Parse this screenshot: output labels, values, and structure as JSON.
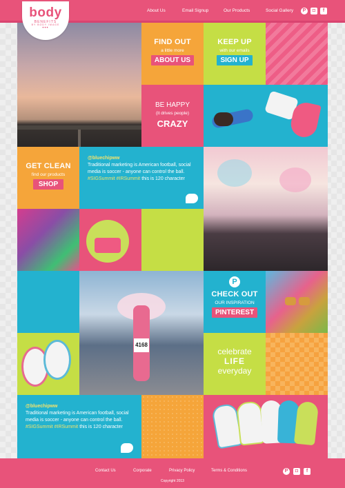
{
  "brand": {
    "name": "body",
    "tagline": "BENEFITS",
    "byline": "BY BODY IMAGE",
    "dots": "•••"
  },
  "nav": [
    {
      "label": "About Us"
    },
    {
      "label": "Email Signup"
    },
    {
      "label": "Our Products"
    },
    {
      "label": "Social Gallery"
    }
  ],
  "social": [
    {
      "icon": "pinterest-icon",
      "glyph": "P"
    },
    {
      "icon": "instagram-icon",
      "glyph": "◘"
    },
    {
      "icon": "facebook-icon",
      "glyph": "f"
    }
  ],
  "tiles": {
    "about": {
      "title": "FIND OUT",
      "sub": "a little more",
      "button": "ABOUT US"
    },
    "signup": {
      "title": "KEEP UP",
      "sub": "with our emails",
      "button": "SIGN UP"
    },
    "happy": {
      "title": "BE HAPPY",
      "sub": "(it drives people)",
      "big": "CRAZY"
    },
    "clean": {
      "title": "GET CLEAN",
      "sub": "find our products",
      "button": "SHOP"
    },
    "tweet1": {
      "handle": "@bluechipww",
      "text": "Traditional marketing is American football, social media is soccer - anyone can control the ball.",
      "tags": "#SIGSummit #IRSummit",
      "tail": "this is 120 character"
    },
    "pinterest": {
      "title": "CHECK OUT",
      "sub": "OUR INSPIRATION",
      "button": "PINTEREST"
    },
    "celebrate": {
      "line1": "celebrate",
      "line2": "LIFE",
      "line3": "everyday"
    },
    "tweet2": {
      "handle": "@bluechipww",
      "text": "Traditional marketing is American football, social media is soccer - anyone can control the ball.",
      "tags": "#SIGSummit #IRSummit",
      "tail": "this is 120 character"
    },
    "race_bib": "4168"
  },
  "footer": {
    "links": [
      {
        "label": "Contact Us"
      },
      {
        "label": "Corporate"
      },
      {
        "label": "Privacy Policy"
      },
      {
        "label": "Terms & Conditions"
      }
    ],
    "copyright": "Copyright 2013"
  },
  "colors": {
    "pink": "#e8537a",
    "orange": "#f5a53a",
    "green": "#c5de45",
    "teal": "#23b2cf",
    "yellow_accent": "#f2e36c"
  }
}
